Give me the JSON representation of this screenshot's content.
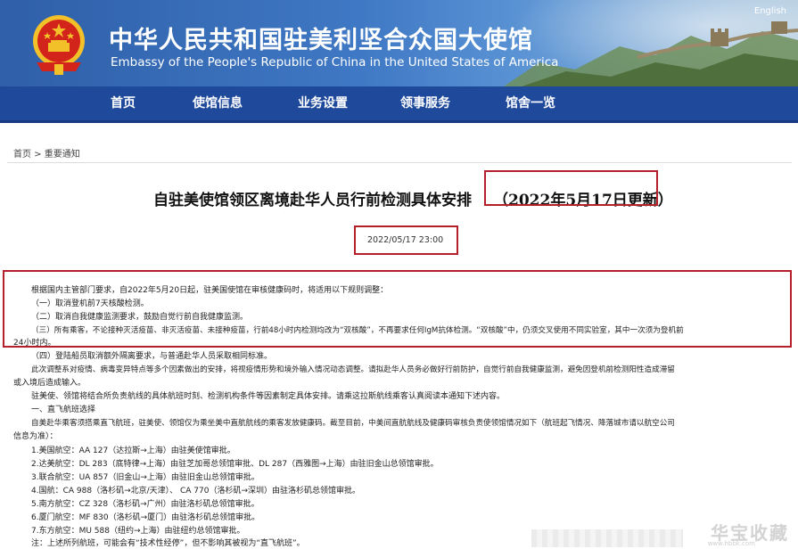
{
  "header": {
    "title_cn": "中华人民共和国驻美利坚合众国大使馆",
    "title_en": "Embassy of the People's Republic of China in the United States of America",
    "lang_link": "English"
  },
  "nav": {
    "items": [
      "首页",
      "使馆信息",
      "业务设置",
      "领事服务",
      "馆舍一览"
    ]
  },
  "breadcrumb": "首页 > 重要通知",
  "article": {
    "title": "自驻美使馆领区离境赴华人员行前检测具体安排",
    "update_note": "（2022年5月17日更新）",
    "date": "2022/05/17 23:00",
    "rules": [
      "根据国内主管部门要求，自2022年5月20日起，驻美国使馆在审核健康码时，将适用以下规则调整：",
      "（一）取消登机前7天核酸检测。",
      "（二）取消自我健康监测要求，鼓励自觉行前自我健康监测。",
      "（三）所有乘客，不论接种灭活疫苗、非灭活疫苗、未接种疫苗，行前48小时内检测均改为“双核酸”，不再要求任何IgM抗体检测。“双核酸”中，仍须交叉使用不同实验室，其中一次须为登机前",
      "24小时内。"
    ],
    "paragraphs": [
      "（四）登陆船员取消额外隔离要求，与普通赴华人员采取相同标准。",
      "此次调整系对疫情、病毒变异特点等多个因素做出的安排，将视疫情形势和境外输入情况动态调整。请拟赴华人员务必做好行前防护，自觉行前自我健康监测，避免因登机前检测阳性造成滞留",
      "或入境后造成输入。",
      "驻美使、领馆将结合所负责航线的具体航班时刻、检测机构条件等因素制定具体安排。请乘这拉斯航线乘客认真阅读本通知下述内容。",
      "一、直飞航班选择",
      "自美赴华乘客须搭乘直飞航班，驻美使、领馆仅为乘坐美中直航航线的乘客发放健康码。截至目前，中美间直航航线及健康码审核负责使领馆情况如下（航班起飞情况、降落城市请以航空公司",
      "信息为准）：",
      "1.美国航空：AA 127（达拉斯→上海）由驻美使馆审批。",
      "2.达美航空：DL 283（底特律→上海）由驻芝加哥总领馆审批、DL 287（西雅图→上海）由驻旧金山总领馆审批。",
      "3.联合航空：UA 857（旧金山→上海）由驻旧金山总领馆审批。",
      "4.国航：CA 988（洛杉矶→北京/天津）、 CA 770（洛杉矶→深圳）由驻洛杉矶总领馆审批。",
      "5.南方航空：CZ 328（洛杉矶→广州）由驻洛杉矶总领馆审批。",
      "6.厦门航空：MF 830（洛杉矶→厦门）由驻洛杉矶总领馆审批。",
      "7.东方航空：MU 588（纽约→上海）由驻纽约总领馆审批。",
      "注：上述所列航班，可能会有“技术性经停”，但不影响其被视为“直飞航班”。"
    ]
  },
  "watermark": {
    "text": "华宝收藏",
    "url": "www.hbbk.com"
  },
  "colors": {
    "banner": "#3f78c4",
    "nav": "#1f4a9c",
    "highlight_box": "#b51f2a"
  }
}
